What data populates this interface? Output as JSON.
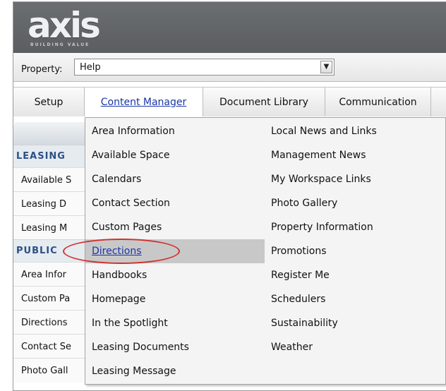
{
  "logo": {
    "main": "axis",
    "sub": "BUILDING VALUE"
  },
  "property": {
    "label": "Property:",
    "value": "Help"
  },
  "tabs": [
    {
      "label": "Setup"
    },
    {
      "label": "Content Manager"
    },
    {
      "label": "Document Library"
    },
    {
      "label": "Communication"
    }
  ],
  "sidebar": {
    "sections": [
      {
        "label": "LEASING",
        "items": [
          "Available S",
          "Leasing D",
          "Leasing M"
        ]
      },
      {
        "label": "PUBLIC",
        "items": [
          "Area Infor",
          "Custom Pa",
          "Directions",
          "Contact Se",
          "Photo Gall"
        ]
      }
    ]
  },
  "menu": {
    "col1": [
      "Area Information",
      "Available Space",
      "Calendars",
      "Contact Section",
      "Custom Pages",
      "Directions",
      "Handbooks",
      "Homepage",
      "In the Spotlight",
      "Leasing Documents",
      "Leasing Message"
    ],
    "col2": [
      "Local News and Links",
      "Management News",
      "My Workspace Links",
      "Photo Gallery",
      "Property Information",
      "Promotions",
      "Register Me",
      "Schedulers",
      "Sustainability",
      "Weather"
    ],
    "highlighted": "Directions"
  },
  "colors": {
    "accent": "#1a35a8",
    "section": "#2b4f86",
    "annotation": "#d23030"
  }
}
